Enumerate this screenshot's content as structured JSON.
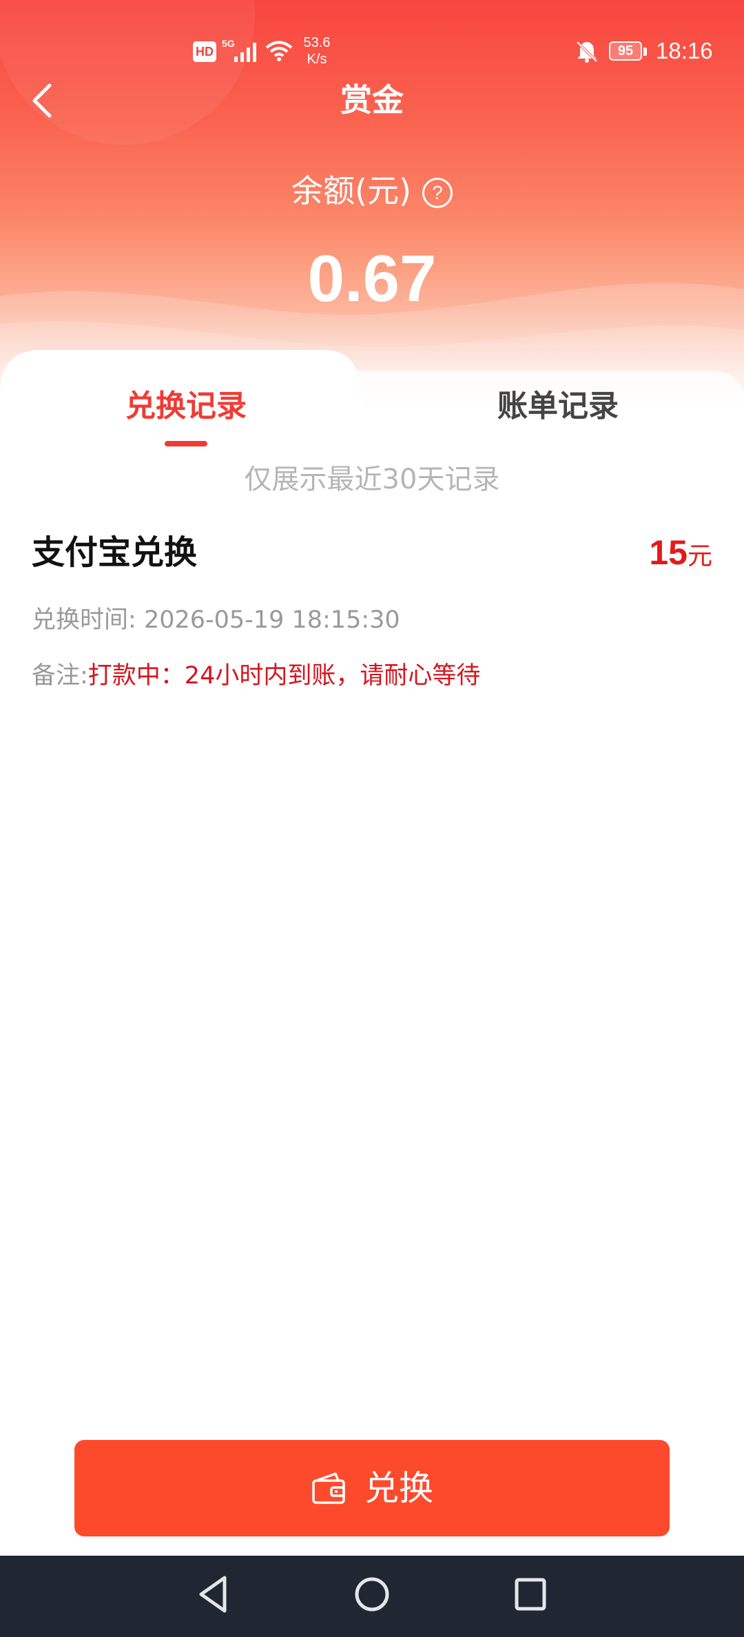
{
  "status_bar": {
    "hd": "HD",
    "network": "5G",
    "speed_value": "53.6",
    "speed_unit": "K/s",
    "battery": "95",
    "time": "18:16",
    "icons": [
      "signal-icon",
      "wifi-icon",
      "bell-muted-icon",
      "battery-icon"
    ]
  },
  "header": {
    "title": "赏金",
    "balance_label": "余额(元)",
    "help_glyph": "?",
    "balance_value": "0.67"
  },
  "tabs": [
    {
      "label": "兑换记录",
      "active": true
    },
    {
      "label": "账单记录",
      "active": false
    }
  ],
  "notice": "仅展示最近30天记录",
  "records": [
    {
      "title": "支付宝兑换",
      "amount": "15",
      "amount_unit": "元",
      "time_label": "兑换时间:",
      "time_value": "2026-05-19 18:15:30",
      "note_label": "备注:",
      "note_value": "打款中：24小时内到账，请耐心等待"
    }
  ],
  "footer": {
    "button_label": "兑换",
    "button_icon": "wallet-icon"
  },
  "nav_bar": {
    "icons": [
      "nav-back-icon",
      "nav-home-icon",
      "nav-recent-icon"
    ]
  },
  "colors": {
    "accent_red": "#ef3b35",
    "amount_red": "#e31a1a",
    "button_orange": "#fe4a2c",
    "nav_bar_bg": "#202632"
  }
}
